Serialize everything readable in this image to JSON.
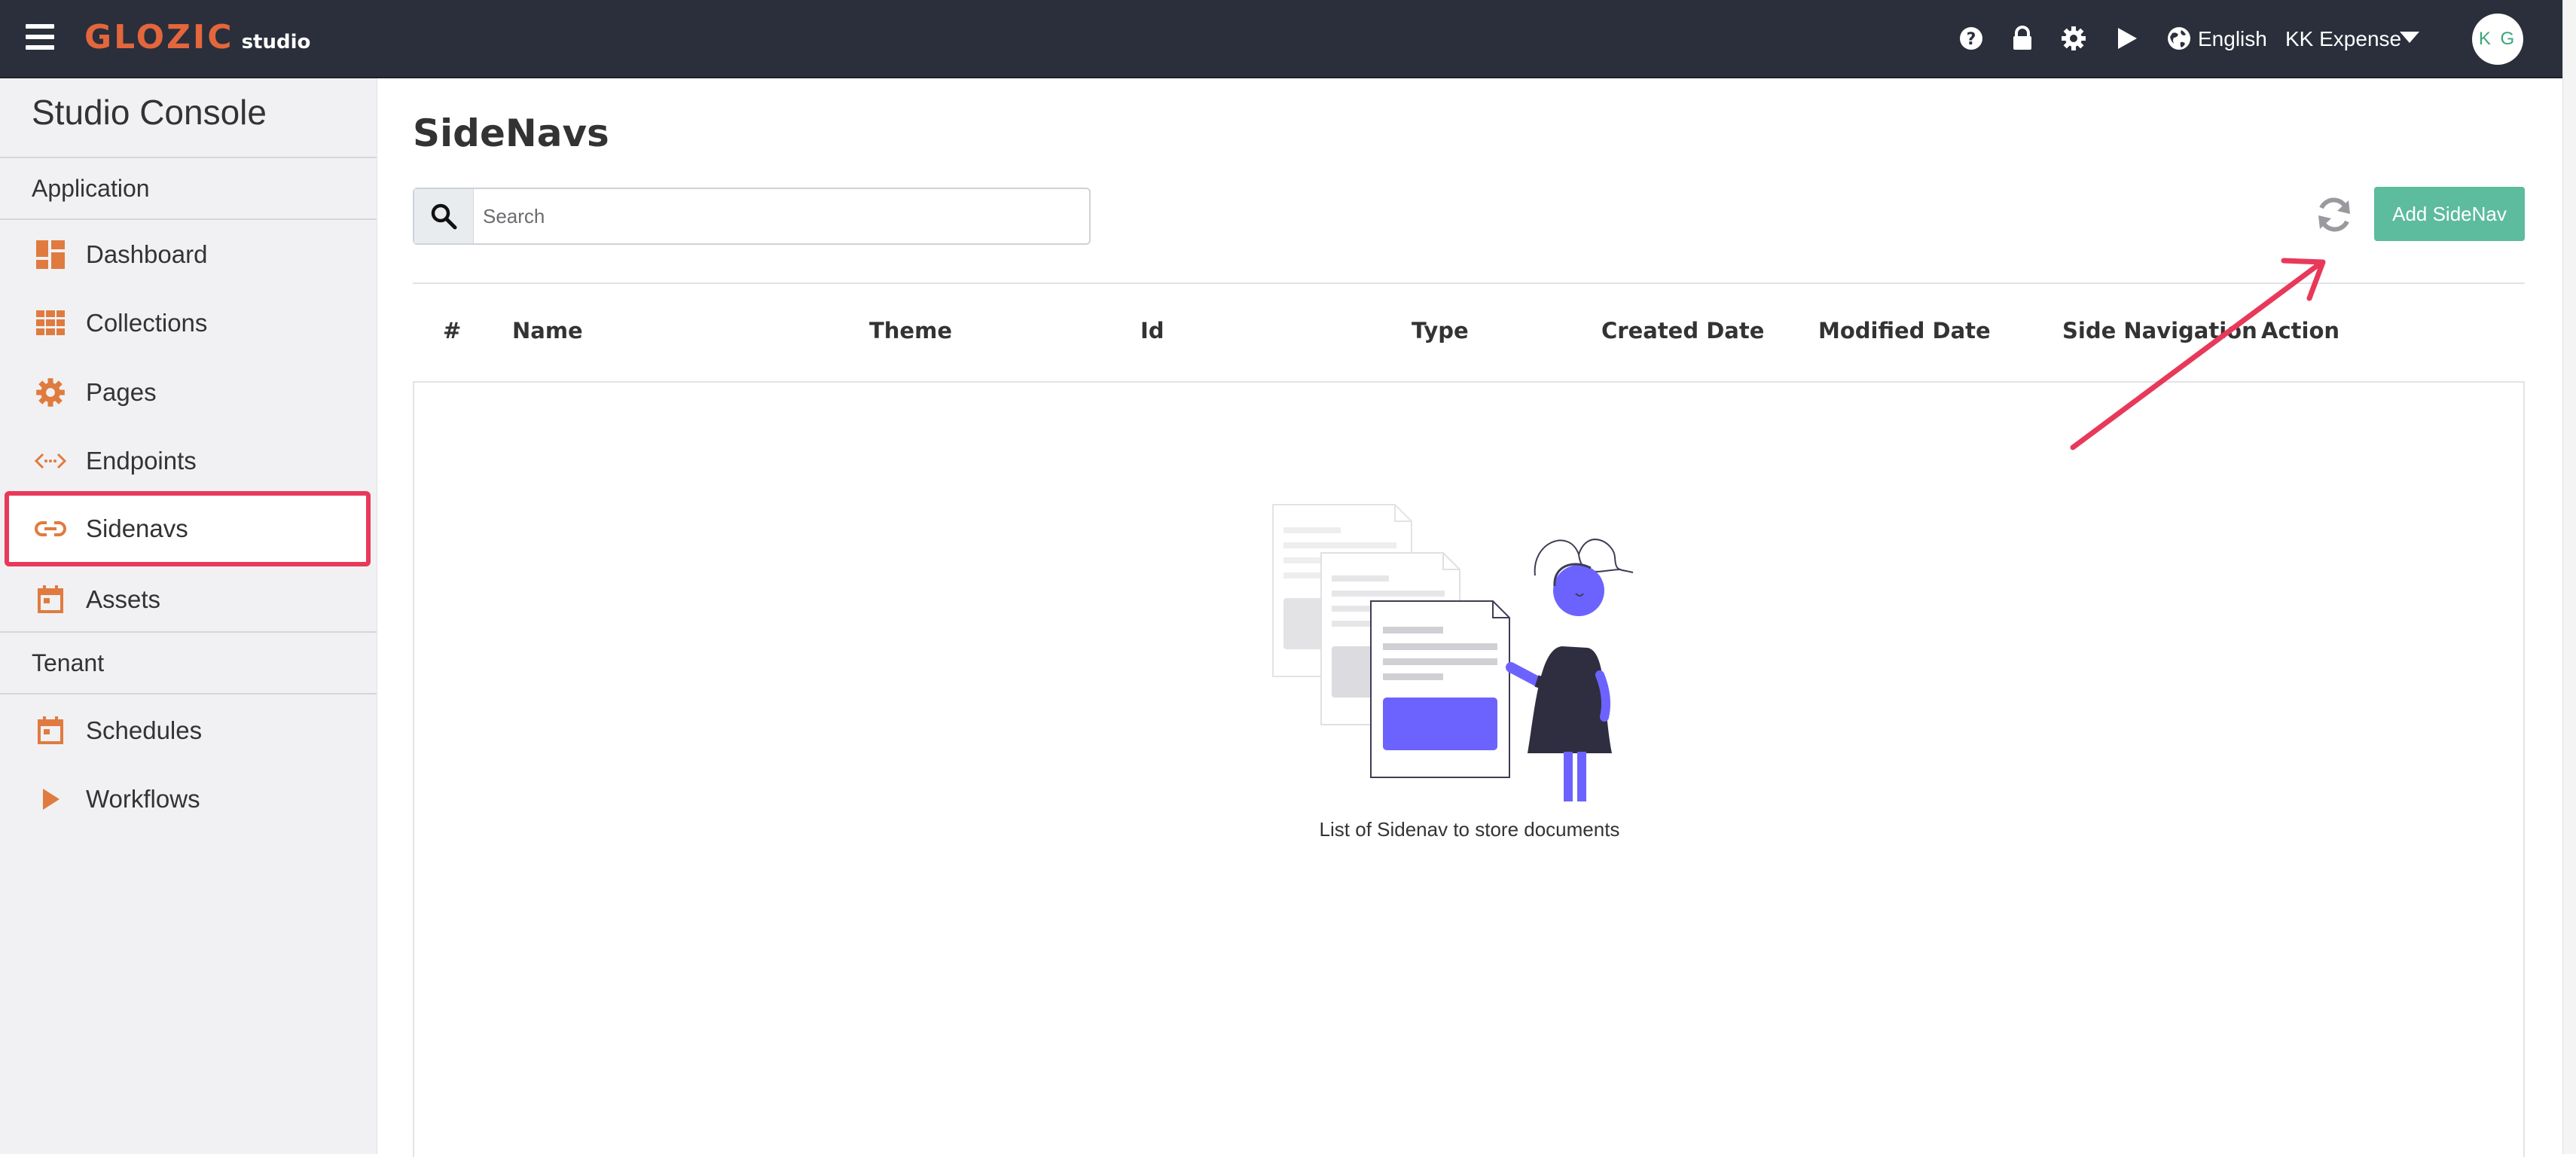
{
  "topbar": {
    "logo_main": "GLOZIC",
    "logo_sub": "studio",
    "language": "English",
    "tenant": "KK Expense",
    "avatar_initials": "K G",
    "icons": [
      "help-icon",
      "lock-icon",
      "gear-icon",
      "play-icon",
      "globe-icon",
      "caret-down-icon"
    ]
  },
  "sidebar": {
    "title": "Studio Console",
    "sections": {
      "application": "Application",
      "tenant": "Tenant"
    },
    "items": [
      {
        "label": "Dashboard",
        "icon": "dashboard-icon"
      },
      {
        "label": "Collections",
        "icon": "grid-icon"
      },
      {
        "label": "Pages",
        "icon": "gear-icon"
      },
      {
        "label": "Endpoints",
        "icon": "code-icon"
      },
      {
        "label": "Sidenavs",
        "icon": "link-icon",
        "active": true
      },
      {
        "label": "Assets",
        "icon": "calendar-icon"
      },
      {
        "label": "Schedules",
        "icon": "calendar-icon"
      },
      {
        "label": "Workflows",
        "icon": "play-icon"
      }
    ]
  },
  "main": {
    "title": "SideNavs",
    "search_placeholder": "Search",
    "add_button": "Add SideNav",
    "columns": [
      "#",
      "Name",
      "Theme",
      "Id",
      "Type",
      "Created Date",
      "Modified Date",
      "Side Navigation",
      "Action"
    ],
    "empty_message": "List of Sidenav to store documents"
  },
  "colors": {
    "topbar": "#2a2f3b",
    "brand": "#e4663c",
    "accent": "#5dbb9e",
    "highlight": "#e8395a",
    "illustration": "#6c63ff"
  }
}
